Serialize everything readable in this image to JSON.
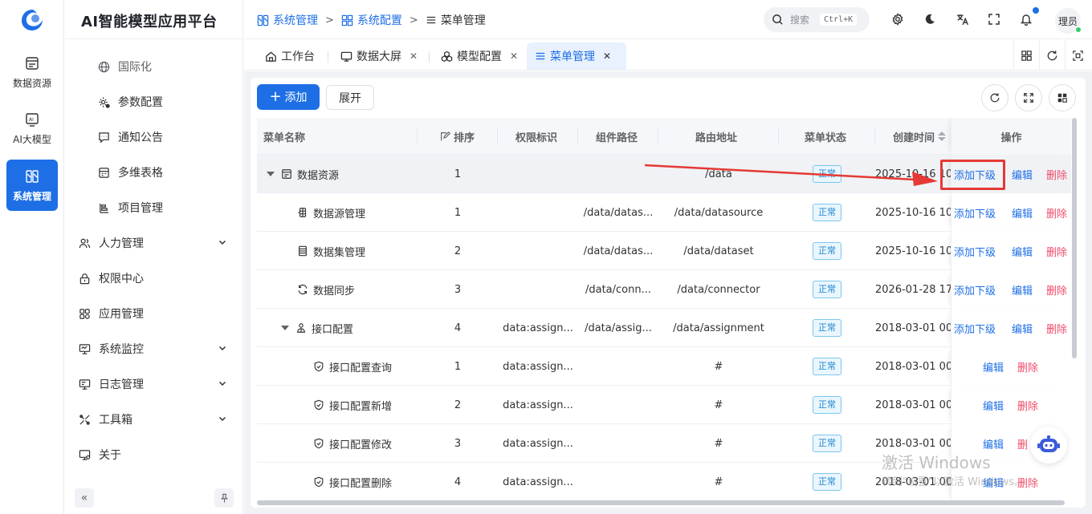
{
  "rail": {
    "items": [
      {
        "label": "数据资源",
        "icon": "database-icon"
      },
      {
        "label": "AI大模型",
        "icon": "ai-icon"
      },
      {
        "label": "系统管理",
        "icon": "system-icon",
        "active": true
      }
    ]
  },
  "app_title": "AI智能模型应用平台",
  "submenu": {
    "children": [
      {
        "label": "国际化",
        "icon": "globe-icon"
      },
      {
        "label": "参数配置",
        "icon": "settings-icon"
      },
      {
        "label": "通知公告",
        "icon": "notice-icon"
      },
      {
        "label": "多维表格",
        "icon": "table-icon"
      },
      {
        "label": "项目管理",
        "icon": "project-icon"
      }
    ],
    "groups": [
      {
        "label": "人力管理",
        "icon": "users-icon",
        "expandable": true
      },
      {
        "label": "权限中心",
        "icon": "lock-icon",
        "expandable": false
      },
      {
        "label": "应用管理",
        "icon": "apps-icon",
        "expandable": false
      },
      {
        "label": "系统监控",
        "icon": "monitor-icon",
        "expandable": true
      },
      {
        "label": "日志管理",
        "icon": "log-icon",
        "expandable": true
      },
      {
        "label": "工具箱",
        "icon": "tools-icon",
        "expandable": true
      },
      {
        "label": "关于",
        "icon": "about-icon",
        "expandable": false
      }
    ]
  },
  "breadcrumb": [
    "系统管理",
    "系统配置",
    "菜单管理"
  ],
  "search": {
    "placeholder": "搜索",
    "shortcut": "Ctrl+K"
  },
  "user": {
    "avatar_text": "理员"
  },
  "tabs": [
    {
      "label": "工作台",
      "icon": "home-icon",
      "closable": false
    },
    {
      "label": "数据大屏",
      "icon": "screen-icon",
      "closable": true
    },
    {
      "label": "模型配置",
      "icon": "model-icon",
      "closable": true
    },
    {
      "label": "菜单管理",
      "icon": "menu-icon",
      "closable": true,
      "active": true
    }
  ],
  "toolbar": {
    "add_label": "添加",
    "expand_label": "展开"
  },
  "table": {
    "columns": [
      "菜单名称",
      "排序",
      "权限标识",
      "组件路径",
      "路由地址",
      "菜单状态",
      "创建时间",
      "操作"
    ],
    "rows": [
      {
        "name": "数据资源",
        "icon": "database-icon",
        "level": 0,
        "expanded": true,
        "sort": "1",
        "perm": "",
        "component": "",
        "route": "/data",
        "status": "正常",
        "created": "2025-10-16 10",
        "add": "添加下级",
        "edit": "编辑",
        "del": "删除"
      },
      {
        "name": "数据源管理",
        "icon": "datasource-icon",
        "level": 1,
        "sort": "1",
        "perm": "",
        "component": "/data/datas...",
        "route": "/data/datasource",
        "status": "正常",
        "created": "2025-10-16 10",
        "add": "添加下级",
        "edit": "编辑",
        "del": "删除"
      },
      {
        "name": "数据集管理",
        "icon": "dataset-icon",
        "level": 1,
        "sort": "2",
        "perm": "",
        "component": "/data/datas...",
        "route": "/data/dataset",
        "status": "正常",
        "created": "2025-10-16 10",
        "add": "添加下级",
        "edit": "编辑",
        "del": "删除"
      },
      {
        "name": "数据同步",
        "icon": "sync-icon",
        "level": 1,
        "sort": "3",
        "perm": "",
        "component": "/data/conn...",
        "route": "/data/connector",
        "status": "正常",
        "created": "2026-01-28 17",
        "add": "添加下级",
        "edit": "编辑",
        "del": "删除"
      },
      {
        "name": "接口配置",
        "icon": "interface-icon",
        "level": 1,
        "expanded": true,
        "sort": "4",
        "perm": "data:assign...",
        "component": "/data/assig...",
        "route": "/data/assignment",
        "status": "正常",
        "created": "2018-03-01 00",
        "add": "添加下级",
        "edit": "编辑",
        "del": "删除"
      },
      {
        "name": "接口配置查询",
        "icon": "shield-icon",
        "level": 2,
        "sort": "1",
        "perm": "data:assign...",
        "component": "",
        "route": "#",
        "status": "正常",
        "created": "2018-03-01 00",
        "add": "",
        "edit": "编辑",
        "del": "删除"
      },
      {
        "name": "接口配置新增",
        "icon": "shield-icon",
        "level": 2,
        "sort": "2",
        "perm": "data:assign...",
        "component": "",
        "route": "#",
        "status": "正常",
        "created": "2018-03-01 00",
        "add": "",
        "edit": "编辑",
        "del": "删除"
      },
      {
        "name": "接口配置修改",
        "icon": "shield-icon",
        "level": 2,
        "sort": "3",
        "perm": "data:assign...",
        "component": "",
        "route": "#",
        "status": "正常",
        "created": "2018-03-01 00",
        "add": "",
        "edit": "编辑",
        "del": "删"
      },
      {
        "name": "接口配置删除",
        "icon": "shield-icon",
        "level": 2,
        "sort": "4",
        "perm": "data:assign...",
        "component": "",
        "route": "#",
        "status": "正常",
        "created": "2018-03-01 00",
        "add": "",
        "edit": "编辑",
        "del": "删除"
      }
    ]
  },
  "watermark": {
    "line1": "激活 Windows",
    "line2": "转到\"设置\"以激活 Windows。"
  },
  "colors": {
    "primary": "#1e6fe6",
    "danger": "#f04a6a",
    "status": "#1e88d0",
    "annotation": "#e53935"
  }
}
